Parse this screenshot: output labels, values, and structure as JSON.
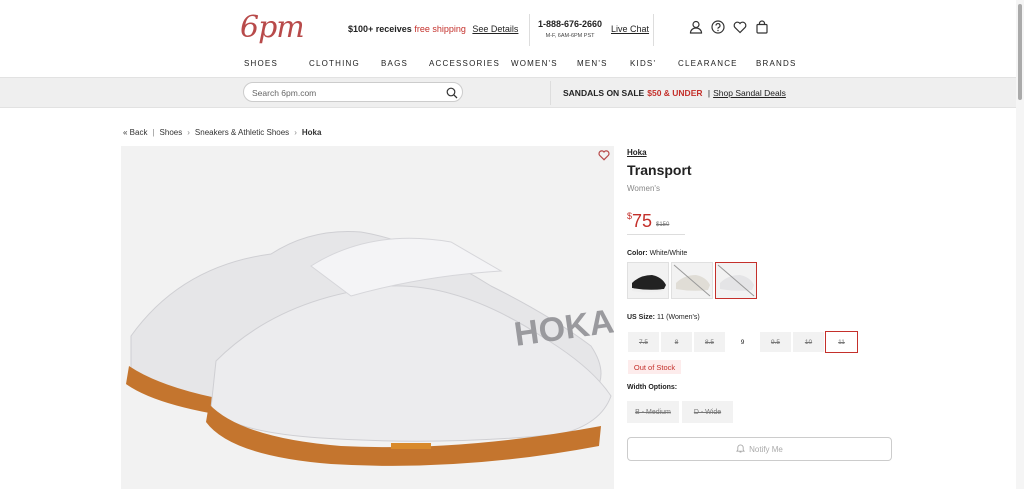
{
  "header": {
    "logo": "6pm",
    "promo_bold": "$100+ receives",
    "promo_highlight": "free shipping",
    "promo_link": "See Details",
    "phone": "1-888-676-2660",
    "hours": "M-F, 6AM-6PM PST",
    "live_chat": "Live Chat",
    "icons": [
      "account-icon",
      "help-icon",
      "heart-icon",
      "bag-icon"
    ]
  },
  "nav": [
    "SHOES",
    "CLOTHING",
    "BAGS",
    "ACCESSORIES",
    "WOMEN'S",
    "MEN'S",
    "KIDS'",
    "CLEARANCE",
    "BRANDS"
  ],
  "search": {
    "placeholder": "Search 6pm.com"
  },
  "sale_banner": {
    "text": "SANDALS ON SALE",
    "highlight": "$50 & UNDER",
    "separator": "|",
    "link": "Shop Sandal Deals"
  },
  "breadcrumb": {
    "back": "« Back",
    "sep": "|",
    "items": [
      "Shoes",
      "Sneakers & Athletic Shoes",
      "Hoka"
    ]
  },
  "product": {
    "brand": "Hoka",
    "name": "Transport",
    "gender": "Women's",
    "price_symbol": "$",
    "price": "75",
    "original_price": "$150",
    "color_label": "Color:",
    "color_value": "White/White",
    "size_label": "US Size:",
    "size_value": "11 (Women's)",
    "sizes": [
      "7.5",
      "8",
      "8.5",
      "9",
      "9.5",
      "10",
      "11"
    ],
    "out_of_stock": "Out of Stock",
    "width_label": "Width Options:",
    "widths": [
      "B - Medium",
      "D - Wide"
    ],
    "notify": "Notify Me"
  },
  "colors": {
    "accent": "#c4302b",
    "logo": "#b84a4a"
  }
}
